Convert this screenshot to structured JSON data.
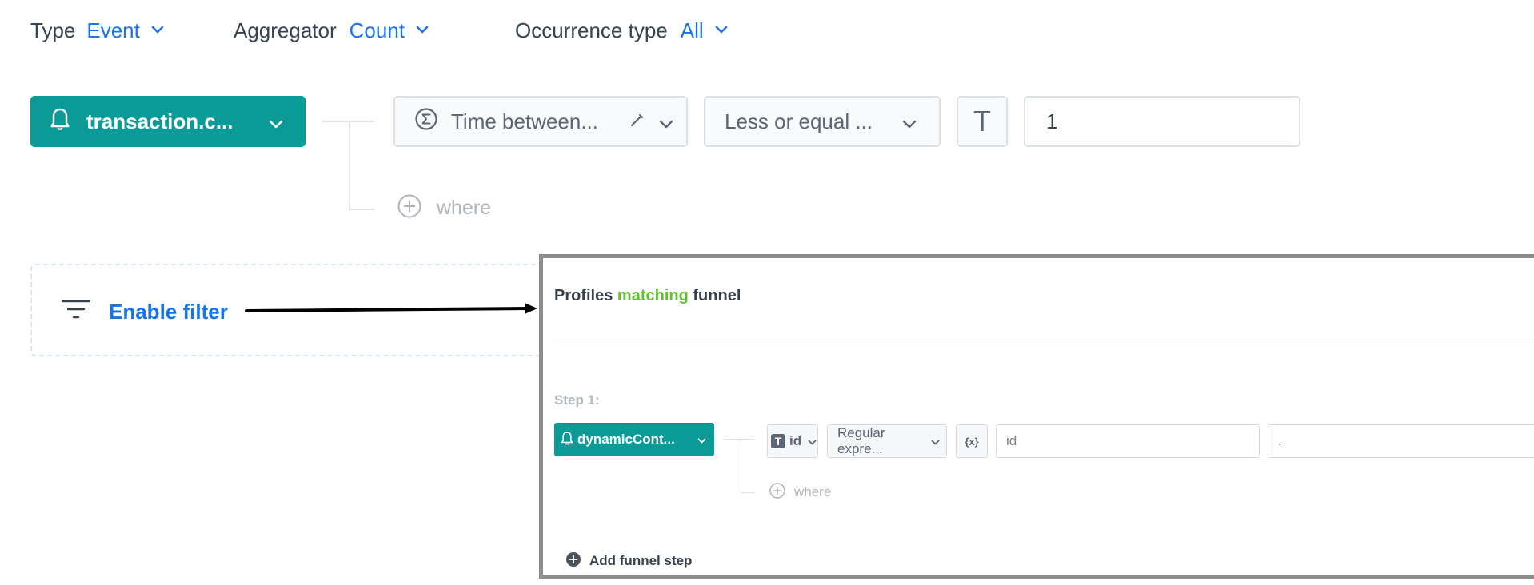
{
  "toolbar": {
    "type_label": "Type",
    "type_value": "Event",
    "aggregator_label": "Aggregator",
    "aggregator_value": "Count",
    "occurrence_label": "Occurrence type",
    "occurrence_value": "All"
  },
  "condition": {
    "event_name": "transaction.c...",
    "attribute": "Time between...",
    "operator": "Less or equal ...",
    "value_type_glyph": "T",
    "value": "1",
    "where_label": "where"
  },
  "filter": {
    "enable_label": "Enable filter"
  },
  "inset": {
    "title_prefix": "Profiles",
    "title_highlight": "matching",
    "title_suffix": "funnel",
    "step_label": "Step 1:",
    "event_name": "dynamicCont...",
    "param_type_glyph": "T",
    "param_name": "id",
    "operator": "Regular expre...",
    "dynamic_key_glyph": "{x}",
    "param_input": "id",
    "param_value": ".",
    "where_label": "where",
    "add_step_label": "Add funnel step"
  },
  "colors": {
    "accent": "#1a73e8",
    "event_teal": "#0c9a96",
    "highlight_green": "#5ec22b"
  }
}
